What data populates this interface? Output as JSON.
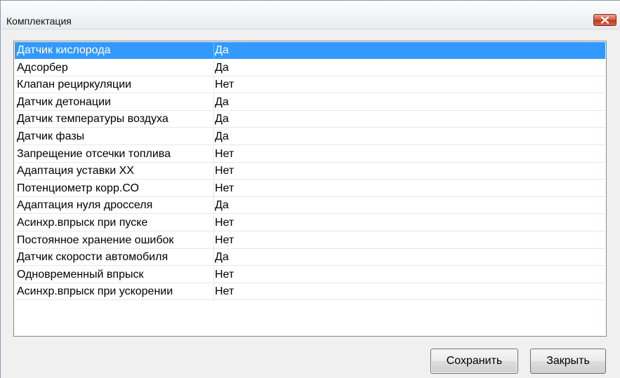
{
  "window": {
    "title": "Комплектация"
  },
  "list": {
    "selected_index": 0,
    "rows": [
      {
        "name": "Датчик кислорода",
        "value": "Да"
      },
      {
        "name": "Адсорбер",
        "value": "Да"
      },
      {
        "name": "Клапан рециркуляции",
        "value": "Нет"
      },
      {
        "name": "Датчик детонации",
        "value": "Да"
      },
      {
        "name": "Датчик температуры воздуха",
        "value": "Да"
      },
      {
        "name": "Датчик фазы",
        "value": "Да"
      },
      {
        "name": "Запрещение отсечки топлива",
        "value": "Нет"
      },
      {
        "name": "Адаптация уставки ХХ",
        "value": "Нет"
      },
      {
        "name": "Потенциометр корр.СО",
        "value": "Нет"
      },
      {
        "name": "Адаптация нуля дросселя",
        "value": "Да"
      },
      {
        "name": "Асинхр.впрыск при пуске",
        "value": "Нет"
      },
      {
        "name": "Постоянное хранение ошибок",
        "value": "Нет"
      },
      {
        "name": "Датчик скорости автомобиля",
        "value": "Да"
      },
      {
        "name": "Одновременный впрыск",
        "value": "Нет"
      },
      {
        "name": "Асинхр.впрыск при ускорении",
        "value": "Нет"
      }
    ]
  },
  "buttons": {
    "save_label": "Сохранить",
    "close_label": "Закрыть"
  },
  "colors": {
    "selection": "#3399ff",
    "close_button": "#c9452a"
  },
  "icons": {
    "close": "close-x-icon"
  }
}
